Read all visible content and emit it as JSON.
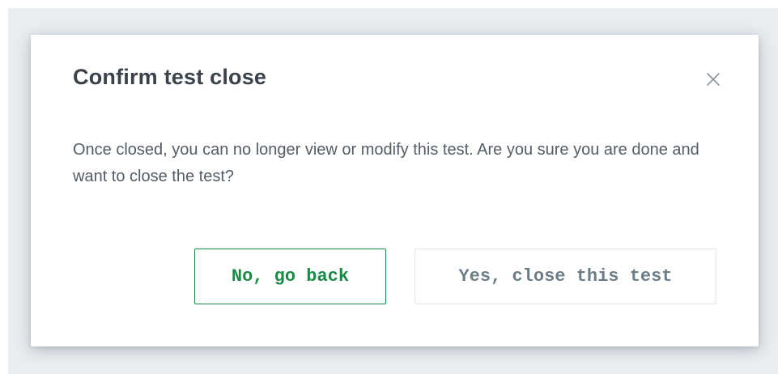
{
  "dialog": {
    "title": "Confirm test close",
    "message": "Once closed, you can no longer view or modify this test. Are you sure you are done and want to close the test?",
    "close_icon": "close-icon",
    "buttons": {
      "cancel_label": "No, go back",
      "confirm_label": "Yes, close this test"
    }
  },
  "colors": {
    "backdrop": "#e9edf0",
    "dialog_background": "#ffffff",
    "title_text": "#3a424b",
    "body_text": "#545c66",
    "accent_green": "#1a8a47",
    "muted_button_text": "#6b7d86",
    "muted_button_border": "#e2e6ea",
    "close_icon": "#8a939b"
  }
}
